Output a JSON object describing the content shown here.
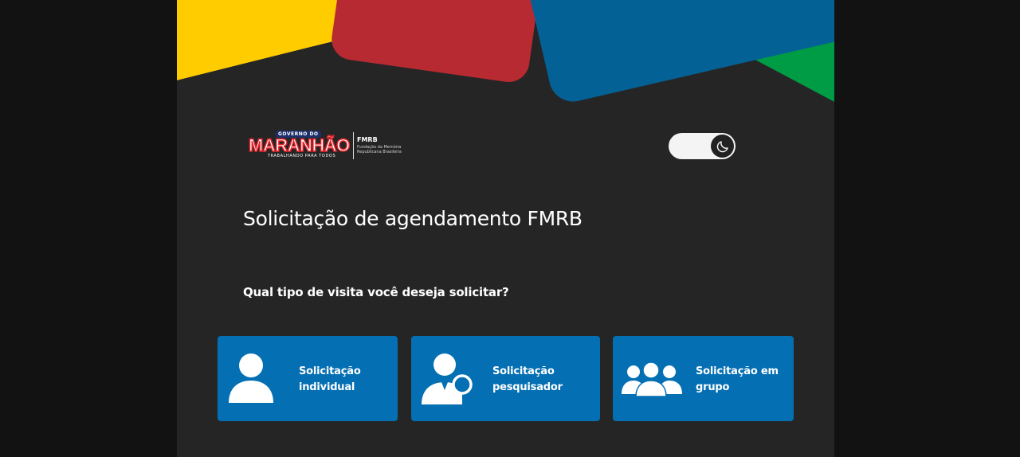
{
  "logo": {
    "gov_text": "GOVERNO DO",
    "brand": "MARANHÃO",
    "tagline": "TRABALHANDO PARA TODOS",
    "org": "FMRB",
    "org_full": "Fundação da Memória Republicana Brasileira"
  },
  "theme_toggle": {
    "icon": "moon-icon",
    "state": "dark"
  },
  "page": {
    "title": "Solicitação de agendamento FMRB",
    "question": "Qual tipo de visita você deseja solicitar?"
  },
  "cards": [
    {
      "label": "Solicitação individual",
      "icon": "person-icon"
    },
    {
      "label": "Solicitação pesquisador",
      "icon": "researcher-icon"
    },
    {
      "label": "Solicitação em grupo",
      "icon": "group-icon"
    }
  ],
  "colors": {
    "background": "#121212",
    "panel": "#252525",
    "card": "#046fb3",
    "yellow": "#ffcc00",
    "red": "#b82a31",
    "blue": "#046195",
    "green": "#009b45"
  }
}
